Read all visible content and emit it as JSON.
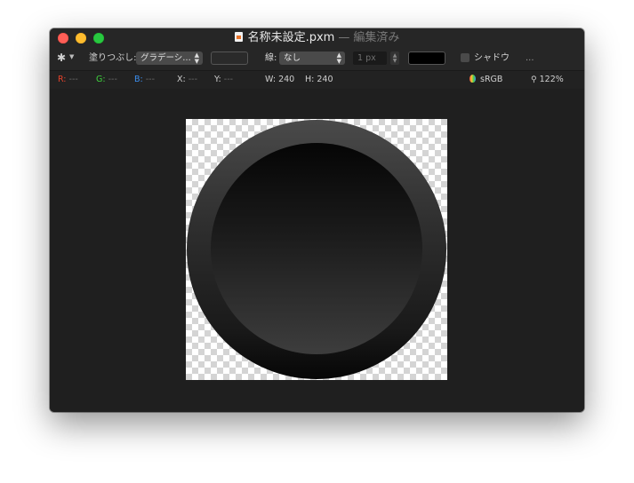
{
  "window": {
    "title": "名称未設定.pxm",
    "title_separator": "—",
    "title_status": "編集済み"
  },
  "toolbar": {
    "gear_icon": "gear-icon",
    "fill_label": "塗りつぶし:",
    "fill_value": "グラデーシ…",
    "stroke_label": "線:",
    "stroke_value": "なし",
    "stroke_width_placeholder": "1 px",
    "shadow_label": "シャドウ",
    "more_label": "..."
  },
  "statusbar": {
    "r_label": "R:",
    "r_value": "---",
    "g_label": "G:",
    "g_value": "---",
    "b_label": "B:",
    "b_value": "---",
    "x_label": "X:",
    "x_value": "---",
    "y_label": "Y:",
    "y_value": "---",
    "w_label": "W:",
    "w_value": "240",
    "h_label": "H:",
    "h_value": "240",
    "color_profile": "sRGB",
    "zoom": "122%"
  },
  "colors": {
    "r": "#e5422b",
    "g": "#3fd33d",
    "b": "#3c8ff0",
    "stroke_color": "#000000"
  }
}
